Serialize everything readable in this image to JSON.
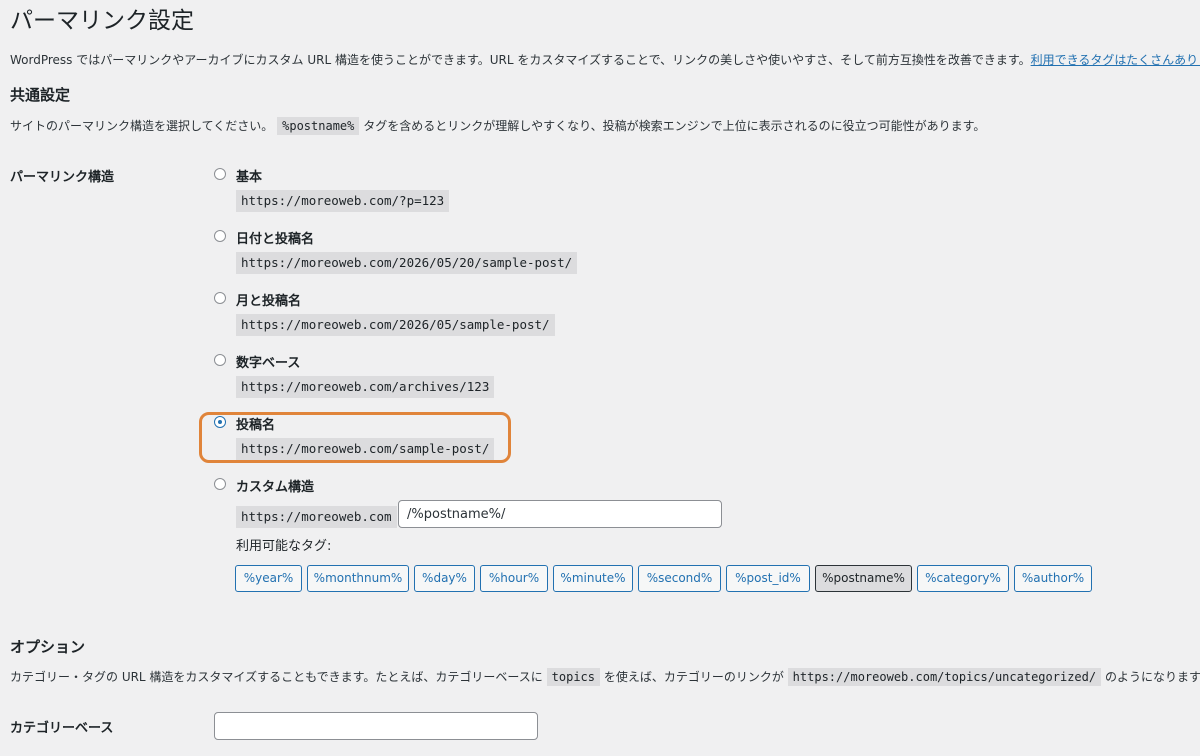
{
  "page": {
    "title": "パーマリンク設定",
    "intro": "WordPress ではパーマリンクやアーカイブにカスタム URL 構造を使うことができます。URL をカスタマイズすることで、リンクの美しさや使いやすさ、そして前方互換性を改善できます。",
    "intro_link": "利用できるタグはたくさんありま"
  },
  "common": {
    "heading": "共通設定",
    "desc_before": "サイトのパーマリンク構造を選択してください。",
    "desc_code": "%postname%",
    "desc_after": "タグを含めるとリンクが理解しやすくなり、投稿が検索エンジンで上位に表示されるのに役立つ可能性があります。",
    "row_label": "パーマリンク構造",
    "options": [
      {
        "label": "基本",
        "example": "https://moreoweb.com/?p=123",
        "checked": false
      },
      {
        "label": "日付と投稿名",
        "example": "https://moreoweb.com/2026/05/20/sample-post/",
        "checked": false
      },
      {
        "label": "月と投稿名",
        "example": "https://moreoweb.com/2026/05/sample-post/",
        "checked": false
      },
      {
        "label": "数字ベース",
        "example": "https://moreoweb.com/archives/123",
        "checked": false
      },
      {
        "label": "投稿名",
        "example": "https://moreoweb.com/sample-post/",
        "checked": true
      },
      {
        "label": "カスタム構造",
        "checked": false
      }
    ],
    "custom": {
      "prefix": "https://moreoweb.com",
      "value": "/%postname%/",
      "tags_label": "利用可能なタグ:",
      "tags": [
        "%year%",
        "%monthnum%",
        "%day%",
        "%hour%",
        "%minute%",
        "%second%",
        "%post_id%",
        "%postname%",
        "%category%",
        "%author%"
      ],
      "active_tag": "%postname%"
    }
  },
  "options_section": {
    "heading": "オプション",
    "desc_1": "カテゴリー・タグの URL 構造をカスタマイズすることもできます。たとえば、カテゴリーベースに",
    "desc_code_1": "topics",
    "desc_2": "を使えば、カテゴリーのリンクが",
    "desc_code_2": "https://moreoweb.com/topics/uncategorized/",
    "desc_3": "のようになります。",
    "category_base_label": "カテゴリーベース",
    "category_base_value": ""
  },
  "colors": {
    "accent": "#2271b1",
    "highlight": "#e0843a",
    "background": "#f0f0f1"
  }
}
